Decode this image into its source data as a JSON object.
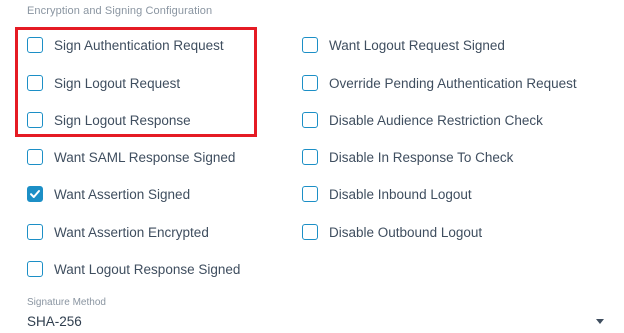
{
  "section_title": "Encryption and Signing Configuration",
  "left_options": [
    {
      "label": "Sign Authentication Request",
      "checked": false
    },
    {
      "label": "Sign Logout Request",
      "checked": false
    },
    {
      "label": "Sign Logout Response",
      "checked": false
    },
    {
      "label": "Want SAML Response Signed",
      "checked": false
    },
    {
      "label": "Want Assertion Signed",
      "checked": true
    },
    {
      "label": "Want Assertion Encrypted",
      "checked": false
    },
    {
      "label": "Want Logout Response Signed",
      "checked": false
    }
  ],
  "right_options": [
    {
      "label": "Want Logout Request Signed",
      "checked": false
    },
    {
      "label": "Override Pending Authentication Request",
      "checked": false
    },
    {
      "label": "Disable Audience Restriction Check",
      "checked": false
    },
    {
      "label": "Disable In Response To Check",
      "checked": false
    },
    {
      "label": "Disable Inbound Logout",
      "checked": false
    },
    {
      "label": "Disable Outbound Logout",
      "checked": false
    }
  ],
  "signature_method": {
    "label": "Signature Method",
    "value": "SHA-256"
  },
  "colors": {
    "accent": "#1c8fc6",
    "highlight": "#e51b24"
  },
  "icons": {
    "checkbox_checked": "check-icon",
    "dropdown": "caret-down-icon"
  }
}
